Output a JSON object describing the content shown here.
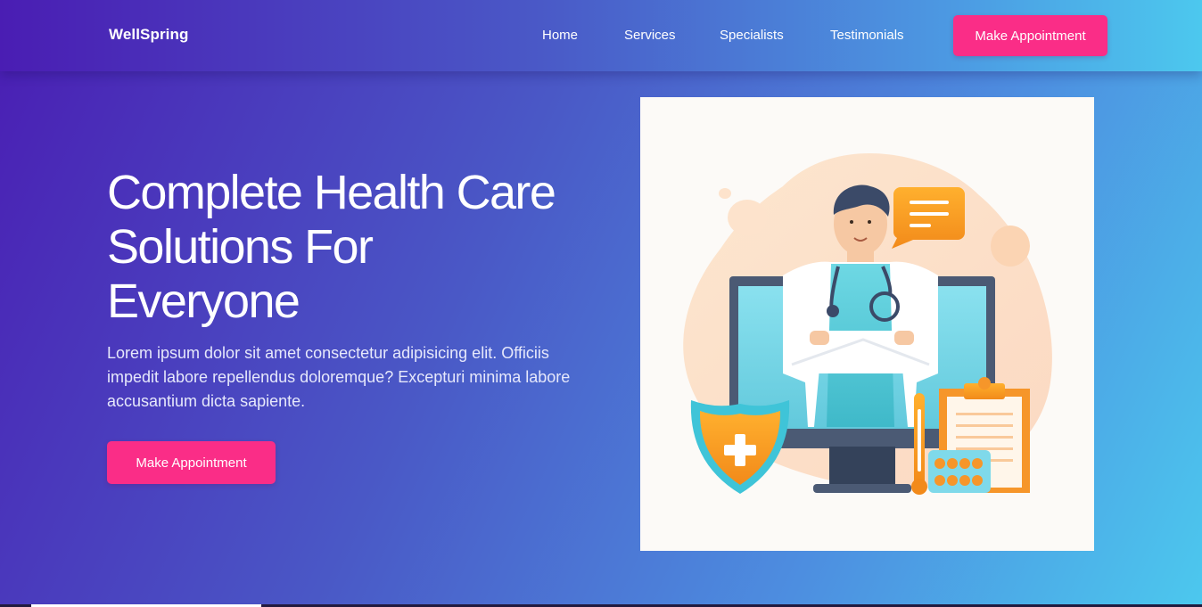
{
  "header": {
    "brand": "WellSpring",
    "nav": [
      {
        "label": "Home"
      },
      {
        "label": "Services"
      },
      {
        "label": "Specialists"
      },
      {
        "label": "Testimonials"
      }
    ],
    "cta_label": "Make Appointment"
  },
  "hero": {
    "title": "Complete Health Care Solutions For Everyone",
    "description": "Lorem ipsum dolor sit amet consectetur adipisicing elit. Officiis impedit labore repellendus doloremque? Excepturi minima labore accusantium dicta sapiente.",
    "cta_label": "Make Appointment",
    "illustration": "doctor-telemedicine-illustration"
  },
  "colors": {
    "accent": "#fa2d87",
    "gradient_start": "#4a1db3",
    "gradient_end": "#4cc8ee",
    "illustration_bg": "#fcfaf7"
  }
}
